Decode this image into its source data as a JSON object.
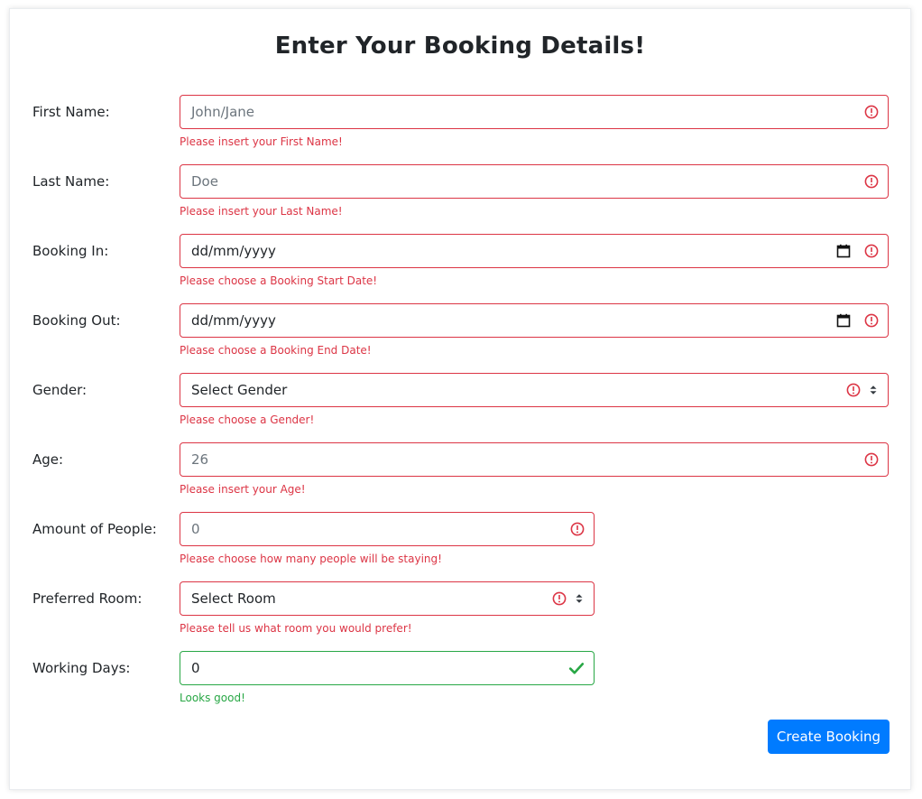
{
  "page": {
    "heading": "Enter Your Booking Details!"
  },
  "colors": {
    "invalid": "#dc3545",
    "valid": "#28a745",
    "primary": "#007bff"
  },
  "form": {
    "first_name": {
      "label": "First Name:",
      "placeholder": "John/Jane",
      "feedback": "Please insert your First Name!",
      "state": "invalid"
    },
    "last_name": {
      "label": "Last Name:",
      "placeholder": "Doe",
      "feedback": "Please insert your Last Name!",
      "state": "invalid"
    },
    "booking_in": {
      "label": "Booking In:",
      "placeholder": "dd/mm/yyyy",
      "feedback": "Please choose a Booking Start Date!",
      "state": "invalid",
      "icon": "calendar-icon"
    },
    "booking_out": {
      "label": "Booking Out:",
      "placeholder": "dd/mm/yyyy",
      "feedback": "Please choose a Booking End Date!",
      "state": "invalid",
      "icon": "calendar-icon"
    },
    "gender": {
      "label": "Gender:",
      "selected": "Select Gender",
      "feedback": "Please choose a Gender!",
      "state": "invalid"
    },
    "age": {
      "label": "Age:",
      "placeholder": "26",
      "feedback": "Please insert your Age!",
      "state": "invalid"
    },
    "people": {
      "label": "Amount of People:",
      "placeholder": "0",
      "feedback": "Please choose how many people will be staying!",
      "state": "invalid"
    },
    "room": {
      "label": "Preferred Room:",
      "selected": "Select Room",
      "feedback": "Please tell us what room you would prefer!",
      "state": "invalid"
    },
    "working_days": {
      "label": "Working Days:",
      "value": "0",
      "feedback": "Looks good!",
      "state": "valid"
    }
  },
  "submit": {
    "label": "Create Booking"
  }
}
